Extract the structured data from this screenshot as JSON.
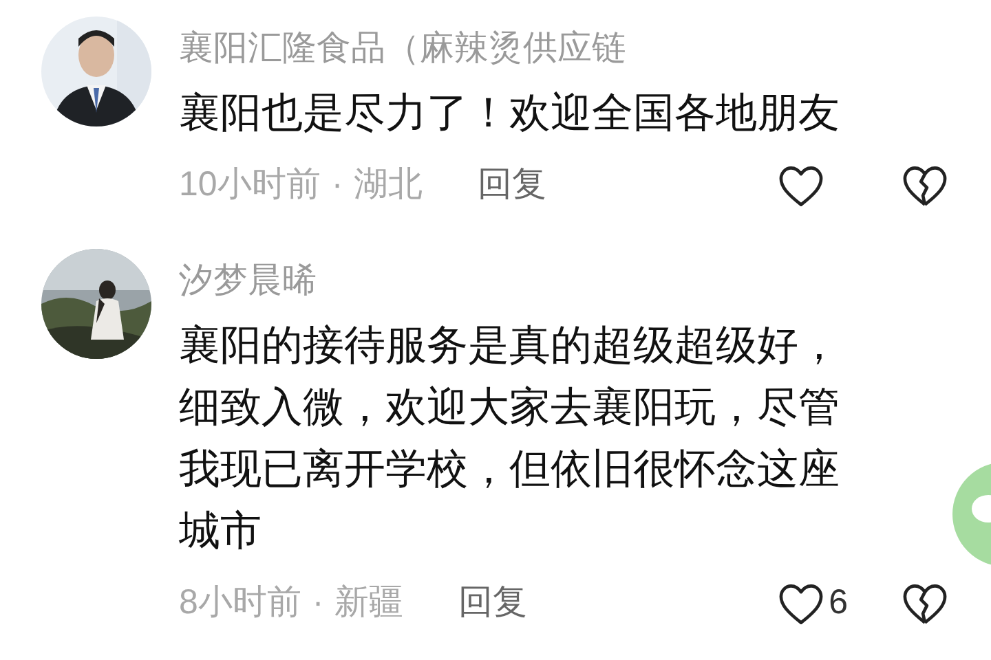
{
  "comments": [
    {
      "author": "襄阳汇隆食品（麻辣烫供应链",
      "lines": [
        "襄阳也是尽力了！欢迎全国各地朋友"
      ],
      "time": "10小时前",
      "separator": "·",
      "region": "湖北",
      "reply": "回复",
      "liked": false
    },
    {
      "author": "汐梦晨晞",
      "lines": [
        "襄阳的接待服务是真的超级超级好，",
        "细致入微，欢迎大家去襄阳玩，尽管",
        "我现已离开学校，但依旧很怀念这座",
        "城市"
      ],
      "time": "8小时前",
      "separator": "·",
      "region": "新疆",
      "reply": "回复",
      "liked": false,
      "like_count": "6"
    }
  ]
}
